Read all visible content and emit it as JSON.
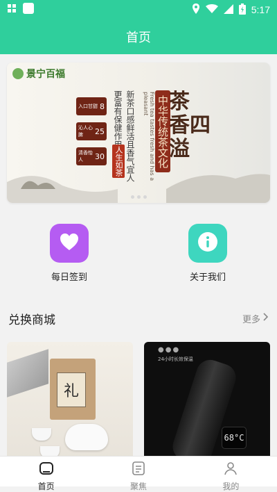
{
  "status_bar": {
    "time": "5:17"
  },
  "app_bar": {
    "title": "首页"
  },
  "banner": {
    "brand": "景宁百福",
    "headline_line1": "茶",
    "headline_line2": "香四",
    "headline_line3": "溢",
    "culture": "中华传统茶文化",
    "english": "Fresh tea tastes fresh and has a pleasant",
    "line1": "新茶口感鲜活且香气宜人",
    "line2": "更富有保健作用",
    "life": "人生如茶",
    "badges": [
      {
        "text": "入口甘甜",
        "num": "8"
      },
      {
        "text": "沁人心脾",
        "num": "25"
      },
      {
        "text": "清香怡人",
        "num": "30"
      }
    ]
  },
  "quick_actions": [
    {
      "label": "每日签到",
      "icon": "heart-icon",
      "color": "#b55cf2"
    },
    {
      "label": "关于我们",
      "icon": "info-icon",
      "color": "#3ed6bf"
    }
  ],
  "section": {
    "title": "兑换商城",
    "more": "更多"
  },
  "products": [
    {
      "name": "tea-gift-box",
      "label_char": "礼"
    },
    {
      "name": "thermos-bottle",
      "caption": "24小时长效保温",
      "display": "68°C"
    }
  ],
  "tabs": [
    {
      "label": "首页",
      "icon": "home-icon",
      "active": true
    },
    {
      "label": "聚焦",
      "icon": "news-icon",
      "active": false
    },
    {
      "label": "我的",
      "icon": "profile-icon",
      "active": false
    }
  ]
}
